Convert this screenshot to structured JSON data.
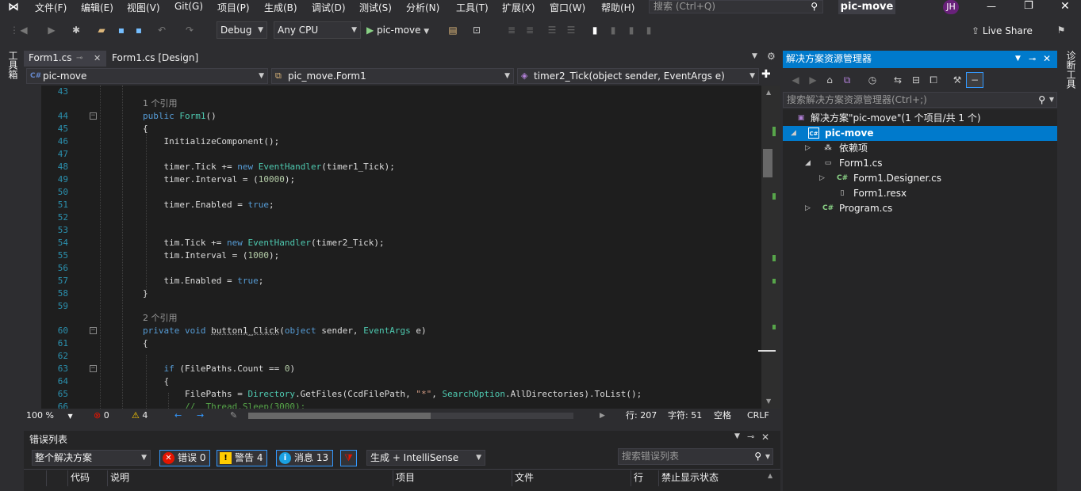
{
  "menubar": {
    "items": [
      "文件(F)",
      "编辑(E)",
      "视图(V)",
      "Git(G)",
      "项目(P)",
      "生成(B)",
      "调试(D)",
      "测试(S)",
      "分析(N)",
      "工具(T)",
      "扩展(X)",
      "窗口(W)",
      "帮助(H)"
    ],
    "search_placeholder": "搜索 (Ctrl+Q)",
    "app_title": "pic-move",
    "user_initials": "JH"
  },
  "toolbar": {
    "config": "Debug",
    "platform": "Any CPU",
    "run_target": "pic-move",
    "live_share": "Live Share"
  },
  "left_strip": {
    "label": "工具箱"
  },
  "right_strip": {
    "label": "诊断工具"
  },
  "editor": {
    "tabs": [
      {
        "label": "Form1.cs",
        "active": true
      },
      {
        "label": "Form1.cs [Design]",
        "active": false
      }
    ],
    "nav": {
      "project": "pic-move",
      "class": "pic_move.Form1",
      "member": "timer2_Tick(object sender, EventArgs e)"
    },
    "lines": [
      {
        "n": "43",
        "t": ""
      },
      {
        "ref": "1 个引用"
      },
      {
        "n": "44",
        "t": "public Form1()",
        "fold": true
      },
      {
        "n": "45",
        "t": "{"
      },
      {
        "n": "46",
        "t": "    InitializeComponent();"
      },
      {
        "n": "47",
        "t": ""
      },
      {
        "n": "48",
        "t": "    timer.Tick += new EventHandler(timer1_Tick);"
      },
      {
        "n": "49",
        "t": "    timer.Interval = (10000);"
      },
      {
        "n": "50",
        "t": ""
      },
      {
        "n": "51",
        "t": "    timer.Enabled = true;"
      },
      {
        "n": "52",
        "t": ""
      },
      {
        "n": "53",
        "t": ""
      },
      {
        "n": "54",
        "t": "    tim.Tick += new EventHandler(timer2_Tick);"
      },
      {
        "n": "55",
        "t": "    tim.Interval = (1000);"
      },
      {
        "n": "56",
        "t": ""
      },
      {
        "n": "57",
        "t": "    tim.Enabled = true;"
      },
      {
        "n": "58",
        "t": "}"
      },
      {
        "n": "59",
        "t": ""
      },
      {
        "ref": "2 个引用"
      },
      {
        "n": "60",
        "t": "private void button1_Click(object sender, EventArgs e)",
        "fold": true
      },
      {
        "n": "61",
        "t": "{"
      },
      {
        "n": "62",
        "t": ""
      },
      {
        "n": "63",
        "t": "    if (FilePaths.Count == 0)",
        "fold": true
      },
      {
        "n": "64",
        "t": "    {"
      },
      {
        "n": "65",
        "t": "        FilePaths = Directory.GetFiles(CcdFilePath, \"*\", SearchOption.AllDirectories).ToList();"
      },
      {
        "n": "66",
        "t": "        //  Thread.Sleep(3000);"
      }
    ],
    "status": {
      "zoom": "100 %",
      "errors": "0",
      "warnings": "4",
      "line": "行: 207",
      "char": "字符: 51",
      "mode": "空格",
      "eol": "CRLF"
    }
  },
  "error_list": {
    "title": "错误列表",
    "scope": "整个解决方案",
    "errors_label": "错误 0",
    "warnings_label": "警告 4",
    "messages_label": "消息 13",
    "build_filter": "生成 + IntelliSense",
    "search_placeholder": "搜索错误列表",
    "columns": [
      "代码",
      "说明",
      "项目",
      "文件",
      "行",
      "禁止显示状态"
    ]
  },
  "solution_explorer": {
    "title": "解决方案资源管理器",
    "search_placeholder": "搜索解决方案资源管理器(Ctrl+;)",
    "tree": [
      {
        "label": "解决方案\"pic-move\"(1 个项目/共 1 个)",
        "icon": "solution-icon"
      },
      {
        "label": "pic-move",
        "icon": "csharp-project-icon",
        "selected": true
      },
      {
        "label": "依赖项",
        "icon": "dependencies-icon"
      },
      {
        "label": "Form1.cs",
        "icon": "form-icon"
      },
      {
        "label": "Form1.Designer.cs",
        "icon": "csharp-file-icon"
      },
      {
        "label": "Form1.resx",
        "icon": "resx-file-icon"
      },
      {
        "label": "Program.cs",
        "icon": "csharp-file-icon"
      }
    ]
  },
  "colors": {
    "accent": "#007acc",
    "keyword": "#569cd6",
    "type": "#4ec9b0",
    "string": "#d69d85",
    "comment": "#57a64a",
    "line_number": "#2b91af"
  }
}
